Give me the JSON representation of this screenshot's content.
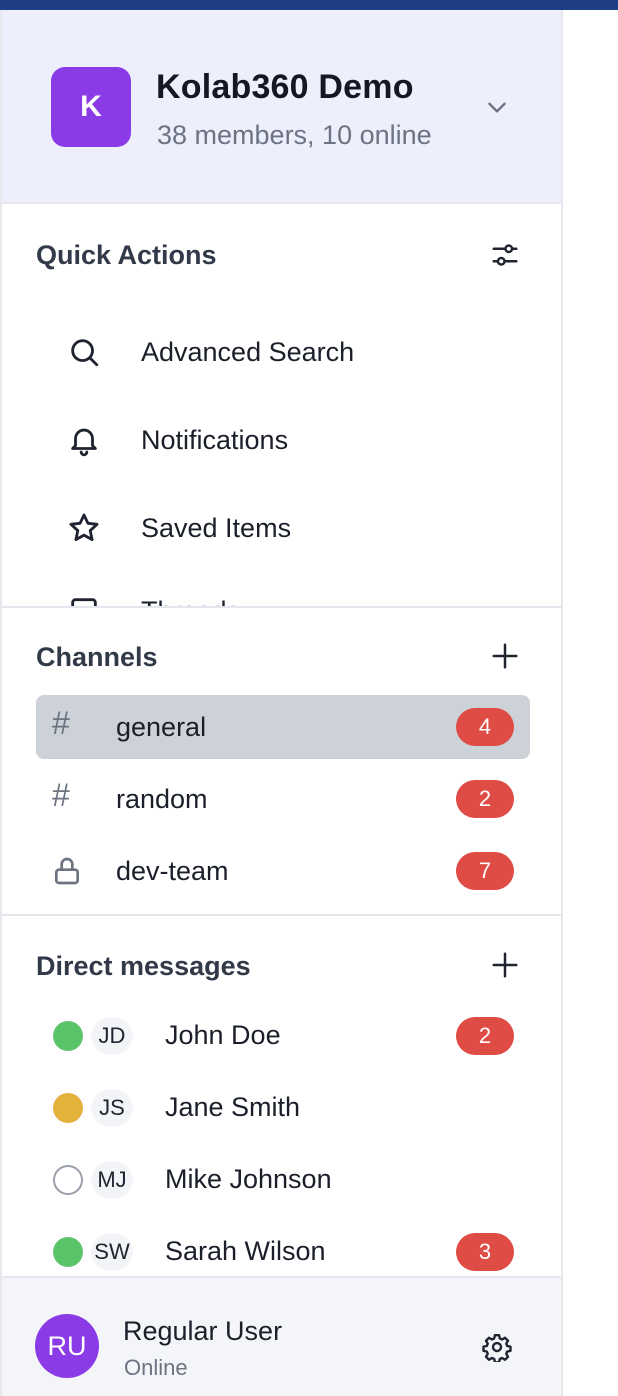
{
  "workspace": {
    "logo_letter": "K",
    "name": "Kolab360 Demo",
    "meta": "38 members, 10 online",
    "accent": "#8a3be6"
  },
  "quick_actions": {
    "title": "Quick Actions",
    "items": [
      {
        "label": "Advanced Search",
        "icon": "search-icon"
      },
      {
        "label": "Notifications",
        "icon": "bell-icon"
      },
      {
        "label": "Saved Items",
        "icon": "star-icon"
      },
      {
        "label": "Threads",
        "icon": "message-square-icon"
      }
    ]
  },
  "channels": {
    "title": "Channels",
    "items": [
      {
        "name": "general",
        "type": "public",
        "unread": "4",
        "active": true
      },
      {
        "name": "random",
        "type": "public",
        "unread": "2",
        "active": false
      },
      {
        "name": "dev-team",
        "type": "private",
        "unread": "7",
        "active": false
      }
    ]
  },
  "direct_messages": {
    "title": "Direct messages",
    "items": [
      {
        "initials": "JD",
        "name": "John Doe",
        "status": "online",
        "unread": "2"
      },
      {
        "initials": "JS",
        "name": "Jane Smith",
        "status": "away",
        "unread": ""
      },
      {
        "initials": "MJ",
        "name": "Mike Johnson",
        "status": "offline",
        "unread": ""
      },
      {
        "initials": "SW",
        "name": "Sarah Wilson",
        "status": "online",
        "unread": "3"
      }
    ]
  },
  "current_user": {
    "initials": "RU",
    "name": "Regular User",
    "status": "Online"
  },
  "colors": {
    "badge": "#df4b45",
    "online": "#5bc46b",
    "away": "#e3b33a",
    "header_bg": "#eeeffd",
    "top_bar": "#1e3f86"
  }
}
